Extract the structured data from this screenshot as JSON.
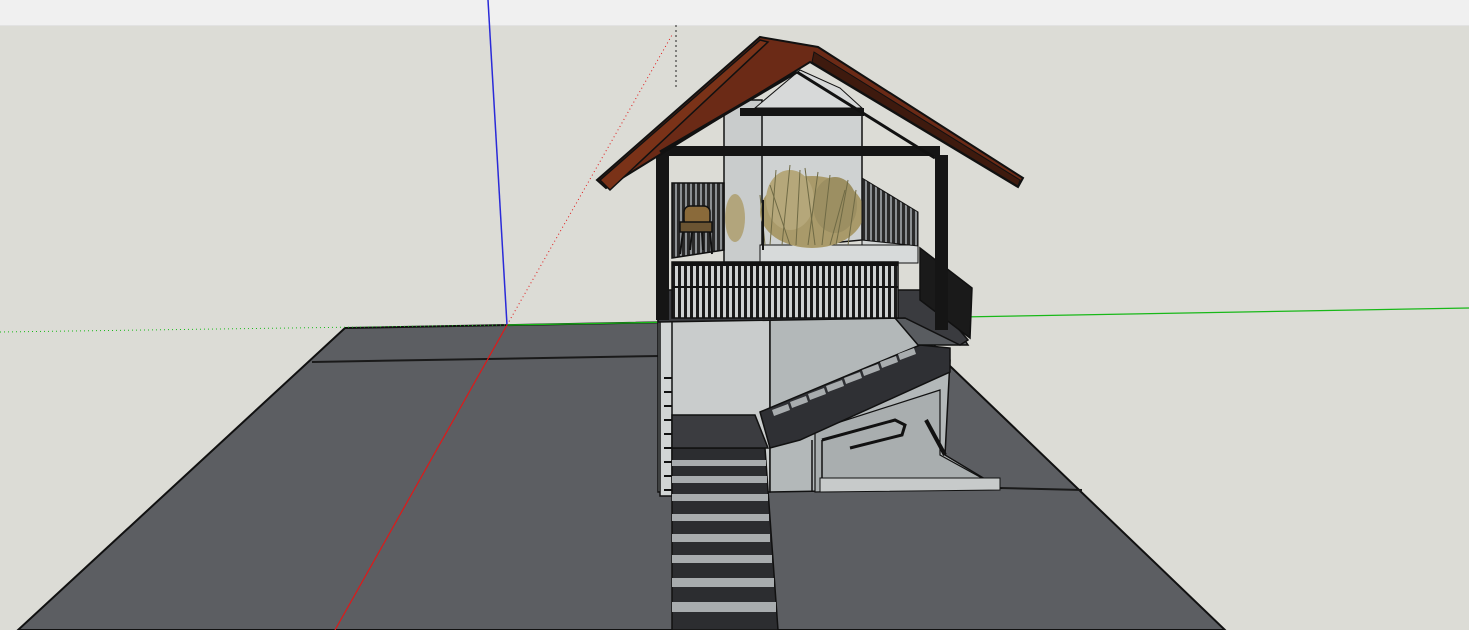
{
  "app": {
    "name": "",
    "mode": "3d-modeling-viewport"
  },
  "viewport": {
    "background_color": "#dcdcd6",
    "ground_color": "#5c5e62",
    "axes": {
      "red": "#e01818",
      "green": "#18b818",
      "blue": "#2a2ad8"
    }
  },
  "model": {
    "roof_color": "#6b2a16",
    "frame_color": "#151515",
    "wall_color": "#c9cccc",
    "planter_grass_color": "#a99a6a",
    "stairs_color": "#3a3b3f"
  },
  "icons": {
    "chair": "armchair-icon",
    "plant": "grass-planter-icon"
  }
}
